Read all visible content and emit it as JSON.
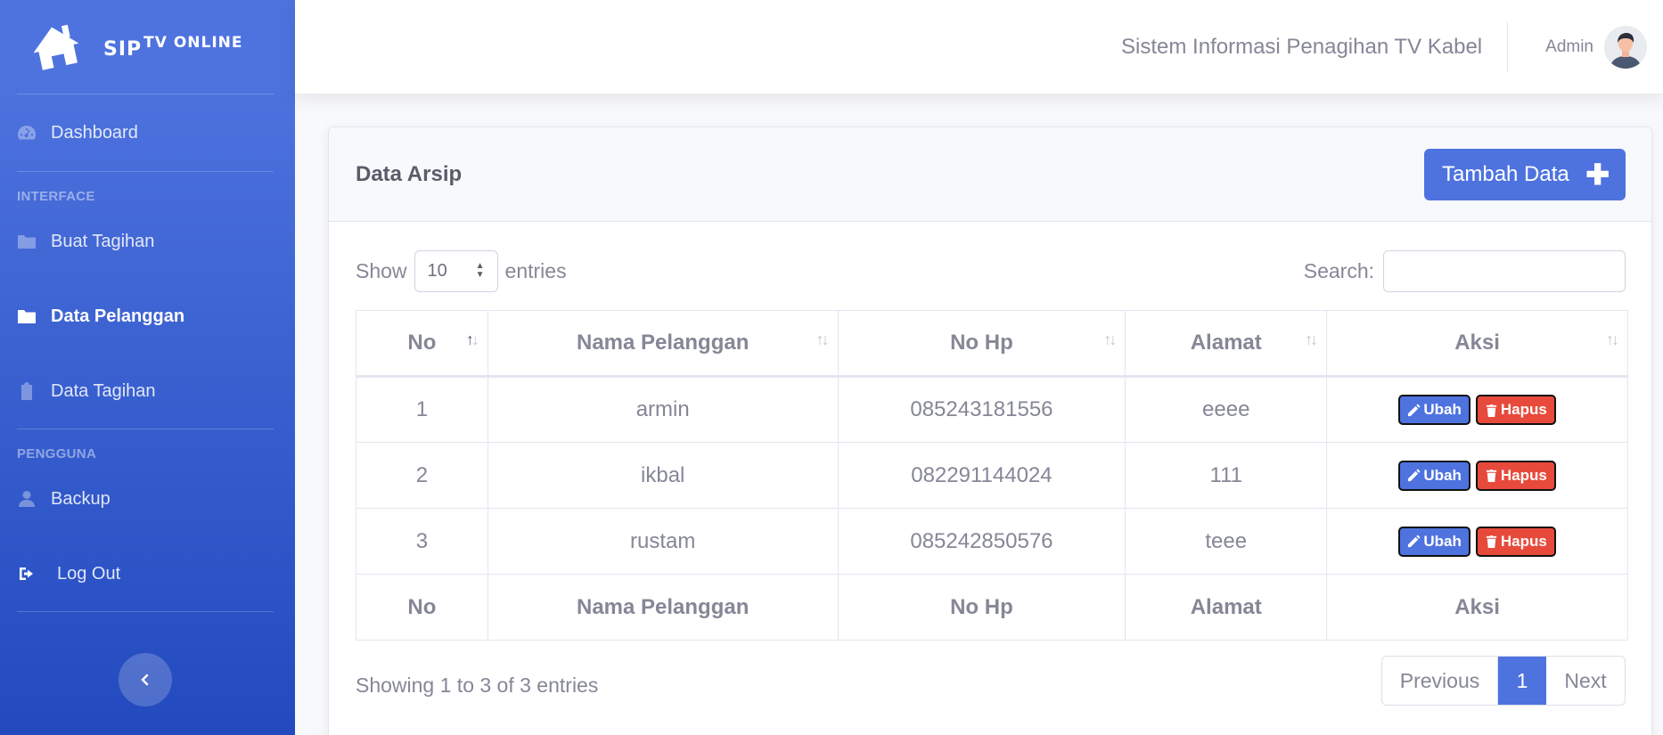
{
  "brand": {
    "name": "SIP",
    "sup": "TV ONLINE"
  },
  "sidebar": {
    "dashboard": "Dashboard",
    "heading_interface": "INTERFACE",
    "buat_tagihan": "Buat Tagihan",
    "data_pelanggan": "Data Pelanggan",
    "data_tagihan": "Data Tagihan",
    "heading_pengguna": "PENGGUNA",
    "backup": "Backup",
    "logout": "Log Out"
  },
  "topbar": {
    "system_title": "Sistem Informasi Penagihan TV Kabel",
    "user": "Admin"
  },
  "card": {
    "title": "Data Arsip",
    "add_button": "Tambah Data"
  },
  "table_controls": {
    "show": "Show",
    "entries_value": "10",
    "entries": "entries",
    "search": "Search:"
  },
  "table": {
    "headers": [
      "No",
      "Nama Pelanggan",
      "No Hp",
      "Alamat",
      "Aksi"
    ],
    "rows": [
      [
        "1",
        "armin",
        "085243181556",
        "eeee"
      ],
      [
        "2",
        "ikbal",
        "082291144024",
        "111"
      ],
      [
        "3",
        "rustam",
        "085242850576",
        "teee"
      ]
    ],
    "edit_label": "Ubah",
    "delete_label": "Hapus"
  },
  "pagination": {
    "info": "Showing 1 to 3 of 3 entries",
    "previous": "Previous",
    "current": "1",
    "next": "Next"
  },
  "colors": {
    "primary": "#4e73df",
    "danger": "#e74a3b",
    "text_muted": "#858796"
  }
}
